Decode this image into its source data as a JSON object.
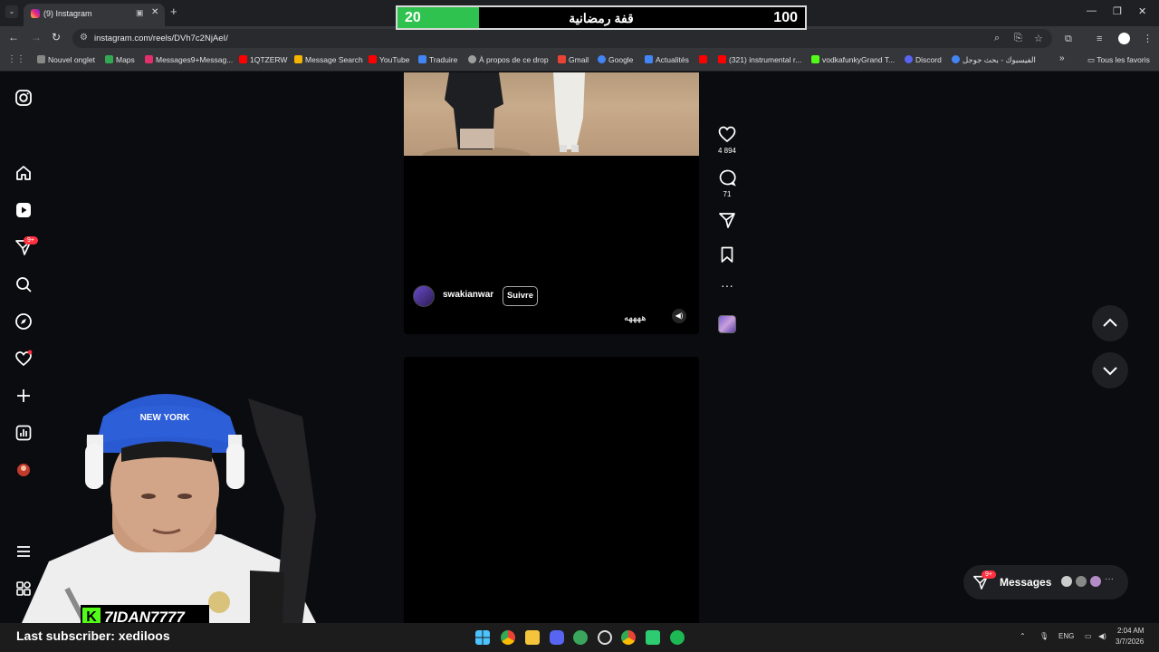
{
  "browser": {
    "tab_title": "(9) Instagram",
    "url": "instagram.com/reels/DVh7c2NjAeI/",
    "new_tab_symbol": "+",
    "bookmarks": [
      {
        "label": "Nouvel onglet",
        "color": "#888888"
      },
      {
        "label": "Maps",
        "color": "#34a853"
      },
      {
        "label": "Messages9+Messag...",
        "color": "#e1306c"
      },
      {
        "label": "1QTZERW",
        "color": "#ff0000"
      },
      {
        "label": "Message Search",
        "color": "#f4b400"
      },
      {
        "label": "YouTube",
        "color": "#ff0000"
      },
      {
        "label": "Traduire",
        "color": "#4285f4"
      },
      {
        "label": "À propos de ce drop",
        "color": "#9e9e9e"
      },
      {
        "label": "Gmail",
        "color": "#ea4335"
      },
      {
        "label": "Google",
        "color": "#4285f4"
      },
      {
        "label": "Actualités",
        "color": "#4285f4"
      },
      {
        "label": "",
        "color": "#ff0000"
      },
      {
        "label": "(321) instrumental r...",
        "color": "#ff0000"
      },
      {
        "label": "vodkafunkyGrand T...",
        "color": "#53fc18"
      },
      {
        "label": "Discord",
        "color": "#5865f2"
      },
      {
        "label": "الفيسبوك - بحث جوجل",
        "color": "#4285f4"
      }
    ],
    "bookmarks_overflow": "»",
    "all_bookmarks": "Tous les favoris"
  },
  "score": {
    "current": "20",
    "label": "قفة رمضانية",
    "max": "100",
    "progress": 0.2,
    "fill_color": "#2fc24e"
  },
  "sidebar": {
    "messages_badge": "9+"
  },
  "reel": {
    "username": "swakianwar",
    "follow_label": "Suivre",
    "caption": "ههههه",
    "likes": "4 894",
    "comments": "71"
  },
  "messages_pill": {
    "label": "Messages",
    "badge": "9+"
  },
  "overlay": {
    "channel": "7IDAN7777",
    "last_subscriber": "Last subscriber: xediloos",
    "cap_text": "NEW YORK"
  },
  "tray": {
    "language": "ENG",
    "time": "2:04 AM",
    "date": "3/7/2026"
  }
}
